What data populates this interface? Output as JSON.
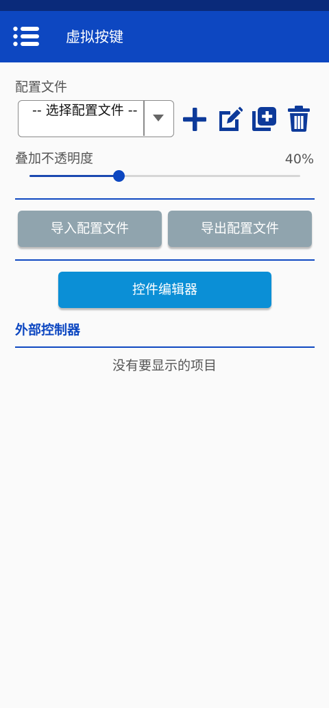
{
  "app_bar": {
    "title": "虚拟按键",
    "menu_icon": "list-menu-icon"
  },
  "profile": {
    "label": "配置文件",
    "selected": "-- 选择配置文件 --",
    "icons": [
      "add-icon",
      "edit-icon",
      "copy-icon",
      "delete-icon"
    ]
  },
  "opacity": {
    "label": "叠加不透明度",
    "value_text": "40%",
    "value": 0.33
  },
  "buttons": {
    "import": "导入配置文件",
    "export": "导出配置文件",
    "editor": "控件编辑器"
  },
  "external": {
    "title": "外部控制器",
    "empty": "没有要显示的项目"
  },
  "colors": {
    "primary": "#0d47c1",
    "status_bar": "#0a2a7a",
    "secondary_button": "#90a4ae",
    "accent_button": "#0b8fd6"
  }
}
